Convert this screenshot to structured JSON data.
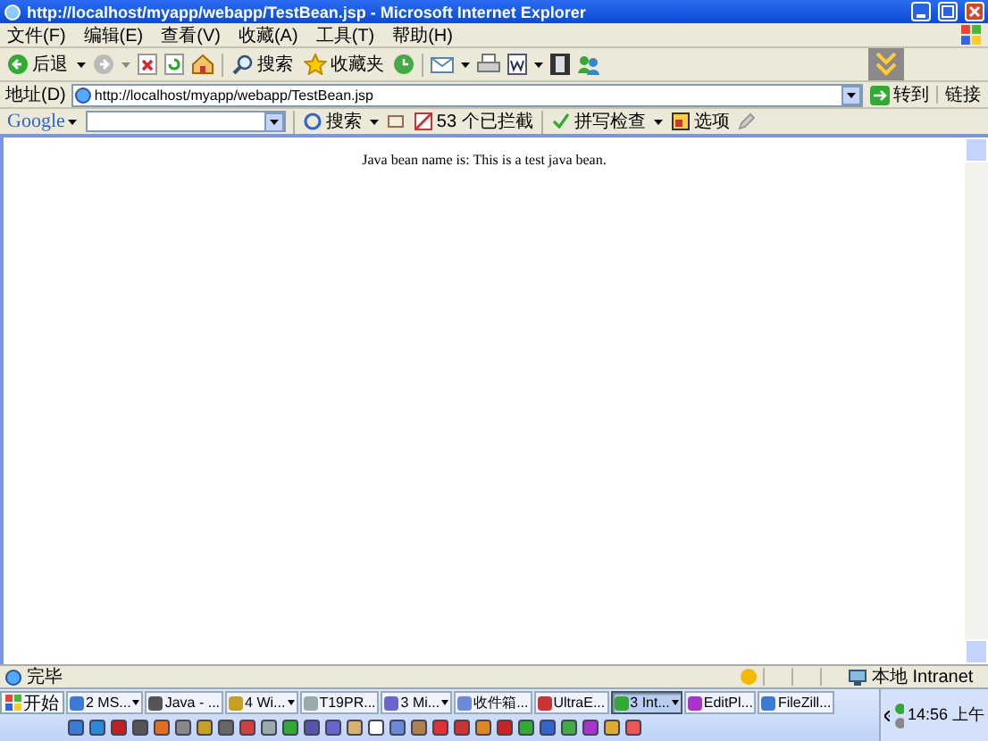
{
  "window": {
    "title": "http://localhost/myapp/webapp/TestBean.jsp - Microsoft Internet Explorer"
  },
  "menu": [
    "文件(F)",
    "编辑(E)",
    "查看(V)",
    "收藏(A)",
    "工具(T)",
    "帮助(H)"
  ],
  "toolbar": {
    "back": "后退",
    "search": "搜索",
    "favorites": "收藏夹"
  },
  "address_bar": {
    "label": "地址(D)",
    "value": "http://localhost/myapp/webapp/TestBean.jsp",
    "go": "转到",
    "links": "链接"
  },
  "google_bar": {
    "logo": "Google",
    "search": "搜索",
    "blocked": "53 个已拦截",
    "spellcheck": "拼写检查",
    "options": "选项"
  },
  "content": {
    "text": "Java bean name is: This is a test java bean."
  },
  "status_bar": {
    "text": "完毕",
    "zone": "本地 Intranet"
  },
  "taskbar": {
    "start": "开始",
    "clock": "14:56 上午",
    "tasks": [
      {
        "label": "2 MS...",
        "grouped": true,
        "selected": false
      },
      {
        "label": "Java - ...",
        "grouped": false,
        "selected": false
      },
      {
        "label": "4 Wi...",
        "grouped": true,
        "selected": false
      },
      {
        "label": "T19PR...",
        "grouped": false,
        "selected": false
      },
      {
        "label": "3 Mi...",
        "grouped": true,
        "selected": false
      },
      {
        "label": "收件箱...",
        "grouped": false,
        "selected": false
      },
      {
        "label": "UltraE...",
        "grouped": false,
        "selected": false
      },
      {
        "label": "3 Int...",
        "grouped": true,
        "selected": true
      },
      {
        "label": "EditPl...",
        "grouped": false,
        "selected": false
      },
      {
        "label": "FileZill...",
        "grouped": false,
        "selected": false
      }
    ]
  }
}
